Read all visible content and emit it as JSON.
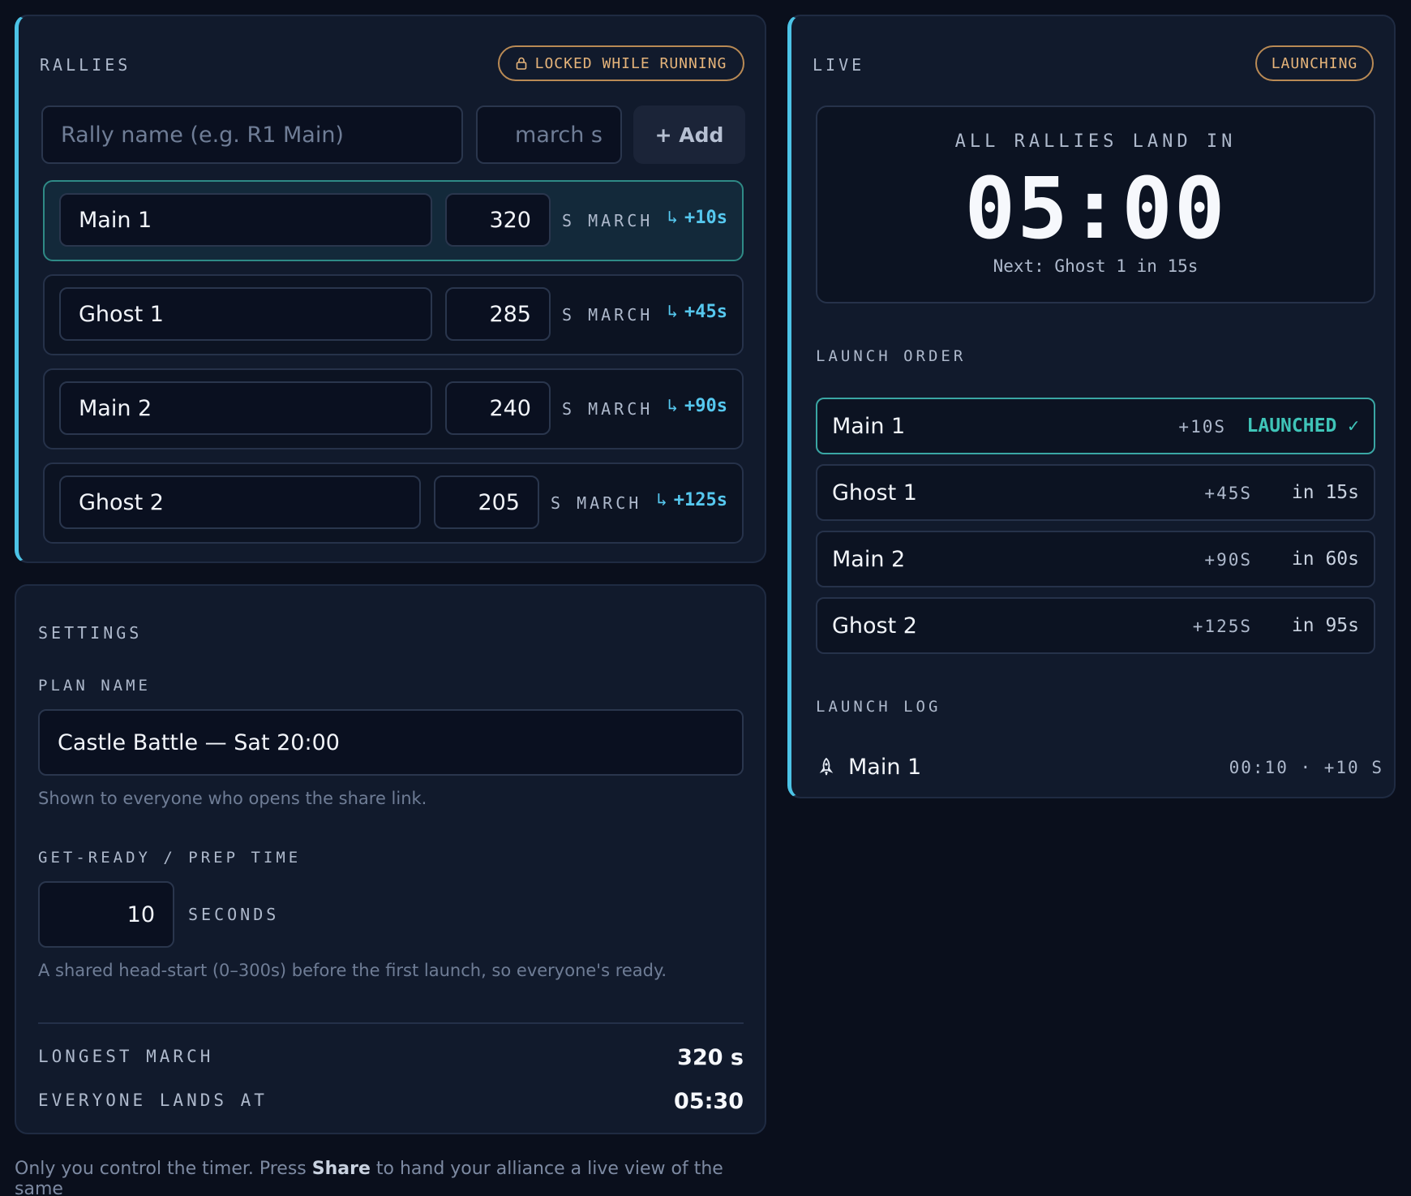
{
  "rallies": {
    "title": "RALLIES",
    "lock_badge": "LOCKED WHILE RUNNING",
    "name_placeholder": "Rally name (e.g. R1 Main)",
    "march_placeholder": "march s",
    "add_label": "+ Add",
    "march_unit": "S MARCH",
    "items": [
      {
        "name": "Main 1",
        "march": "320",
        "offset": "+10s"
      },
      {
        "name": "Ghost 1",
        "march": "285",
        "offset": "+45s"
      },
      {
        "name": "Main 2",
        "march": "240",
        "offset": "+90s"
      },
      {
        "name": "Ghost 2",
        "march": "205",
        "offset": "+125s"
      }
    ]
  },
  "settings": {
    "title": "SETTINGS",
    "plan_name_label": "PLAN NAME",
    "plan_name_value": "Castle Battle — Sat 20:00",
    "plan_name_help": "Shown to everyone who opens the share link.",
    "prep_label": "GET-READY / PREP TIME",
    "prep_value": "10",
    "prep_unit": "SECONDS",
    "prep_help": "A shared head-start (0–300s) before the first launch, so everyone's ready.",
    "longest_label": "LONGEST MARCH",
    "longest_value": "320 s",
    "lands_label": "EVERYONE LANDS AT",
    "lands_value": "05:30"
  },
  "live": {
    "title": "LIVE",
    "status_badge": "LAUNCHING",
    "countdown_label": "ALL RALLIES LAND IN",
    "countdown_value": "05:00",
    "next_text": "Next: Ghost 1 in 15s",
    "order_title": "LAUNCH ORDER",
    "order": [
      {
        "name": "Main 1",
        "offset": "+10S",
        "status": "LAUNCHED ✓"
      },
      {
        "name": "Ghost 1",
        "offset": "+45S",
        "status": "in 15s"
      },
      {
        "name": "Main 2",
        "offset": "+90S",
        "status": "in 60s"
      },
      {
        "name": "Ghost 2",
        "offset": "+125S",
        "status": "in 95s"
      }
    ],
    "log_title": "LAUNCH LOG",
    "log": [
      {
        "name": "Main 1",
        "detail": "00:10 · +10 S"
      }
    ]
  },
  "footer": {
    "text_before": "Only you control the timer. Press ",
    "text_bold": "Share",
    "text_after": " to hand your alliance a live view of the same"
  },
  "colors": {
    "background": "#0a0f1c",
    "accent": "#4cc3e6",
    "launched": "#3fc4b8",
    "badge": "#e6b47a"
  }
}
